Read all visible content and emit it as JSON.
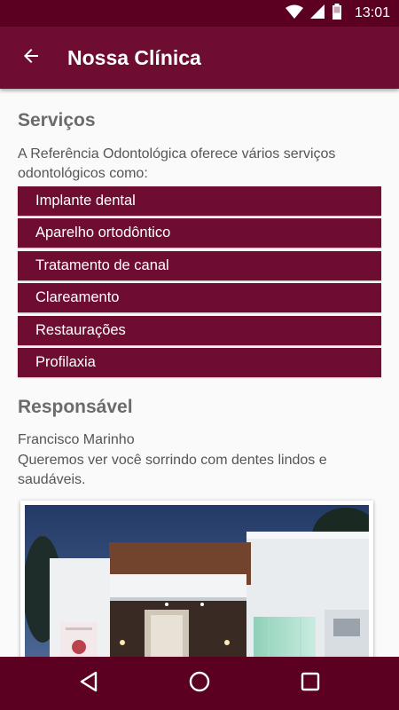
{
  "status_bar": {
    "time": "13:01"
  },
  "app_bar": {
    "title": "Nossa Clínica"
  },
  "services": {
    "heading": "Serviços",
    "intro": "A Referência Odontológica oferece vários serviços odontológicos como:",
    "items": [
      "Implante dental",
      "Aparelho ortodôntico",
      "Tratamento de canal",
      "Clareamento",
      "Restaurações",
      "Profilaxia"
    ]
  },
  "responsible": {
    "heading": "Responsável",
    "name": "Francisco Marinho",
    "message": "Queremos ver você sorrindo com dentes lindos e saudáveis."
  },
  "colors": {
    "primary": "#6f0c31",
    "primary_dark": "#5c0021",
    "background": "#fafafa"
  }
}
